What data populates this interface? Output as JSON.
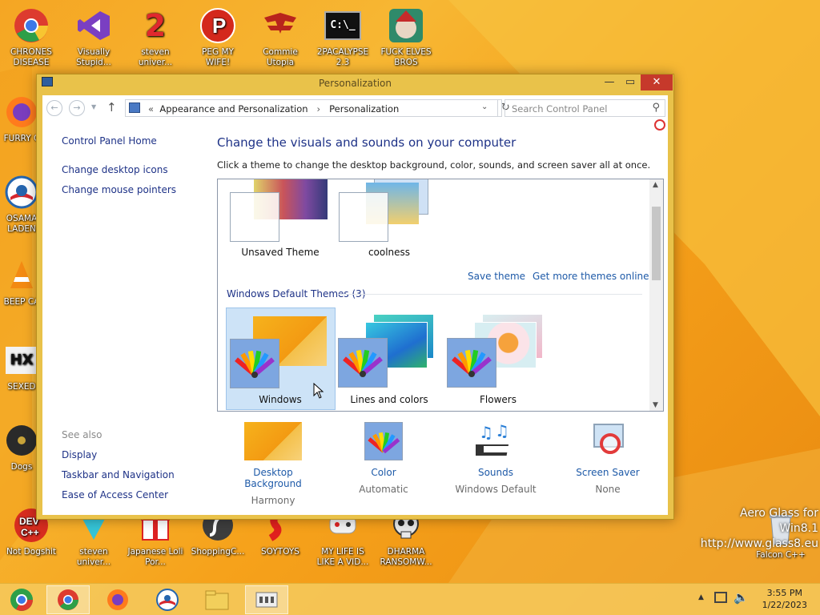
{
  "desktop": {
    "icons_top": [
      {
        "label": "CHRONES DISEASE",
        "icon": "chrome-icon"
      },
      {
        "label": "Visually Stupid...",
        "icon": "visual-studio-icon"
      },
      {
        "label": "steven univer...",
        "icon": "steven-universe-icon"
      },
      {
        "label": "PEG MY WIFE!",
        "icon": "peg-icon"
      },
      {
        "label": "Commie Utopia",
        "icon": "commie-icon"
      },
      {
        "label": "2PACALYPSE 2.3",
        "icon": "cmd-icon"
      },
      {
        "label": "FUCK ELVES BROS",
        "icon": "elves-icon"
      }
    ],
    "icons_left": [
      {
        "label": "FURRY C",
        "icon": "firefox-icon"
      },
      {
        "label": "OSAMA LADEN",
        "icon": "obama-icon"
      },
      {
        "label": "BEEP CA",
        "icon": "vlc-icon"
      },
      {
        "label": "SEXED",
        "icon": "hex-icon"
      },
      {
        "label": "Dogs",
        "icon": "cd-icon"
      }
    ],
    "icons_bottom": [
      {
        "label": "Not Dogshit",
        "icon": "devcpp-icon"
      },
      {
        "label": "steven univer...",
        "icon": "diamond-icon"
      },
      {
        "label": "Japanese Loli Por...",
        "icon": "gift-icon"
      },
      {
        "label": "ShoppingC...",
        "icon": "flash-icon"
      },
      {
        "label": "SOYTOYS",
        "icon": "soytoys-icon"
      },
      {
        "label": "MY LIFE IS LIKE A VID...",
        "icon": "controller-icon"
      },
      {
        "label": "DHARMA RANSOMW...",
        "icon": "skull-icon"
      }
    ],
    "recycle_label": "Falcon C++",
    "watermark_line1": "Aero Glass for Win8.1",
    "watermark_line2": "http://www.glass8.eu"
  },
  "window": {
    "title": "Personalization",
    "minimize": "—",
    "maximize": "▭",
    "close": "✕",
    "address": {
      "prefix": "«",
      "crumb1": "Appearance and Personalization",
      "sep": "›",
      "crumb2": "Personalization"
    },
    "search_placeholder": "Search Control Panel",
    "left_links": {
      "home": "Control Panel Home",
      "desktop_icons": "Change desktop icons",
      "mouse_pointers": "Change mouse pointers",
      "see_also": "See also",
      "display": "Display",
      "taskbar": "Taskbar and Navigation",
      "ease": "Ease of Access Center"
    },
    "heading": "Change the visuals and sounds on your computer",
    "subheading": "Click a theme to change the desktop background, color, sounds, and screen saver all at once.",
    "my_themes": [
      {
        "name": "Unsaved Theme"
      },
      {
        "name": "coolness"
      }
    ],
    "save_theme": "Save theme",
    "get_more": "Get more themes online",
    "default_section": "Windows Default Themes (3)",
    "default_themes": [
      {
        "name": "Windows"
      },
      {
        "name": "Lines and colors"
      },
      {
        "name": "Flowers"
      }
    ],
    "bottom": [
      {
        "label": "Desktop Background",
        "value": "Harmony"
      },
      {
        "label": "Color",
        "value": "Automatic"
      },
      {
        "label": "Sounds",
        "value": "Windows Default"
      },
      {
        "label": "Screen Saver",
        "value": "None"
      }
    ]
  },
  "taskbar": {
    "time": "3:55 PM",
    "date": "1/22/2023",
    "tray_arrow": "▲"
  }
}
